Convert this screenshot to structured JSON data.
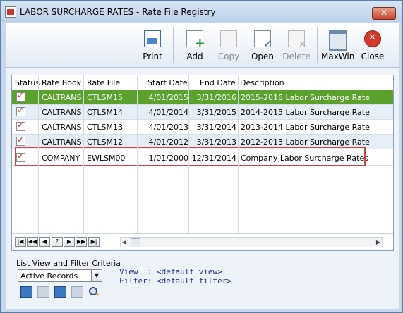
{
  "window": {
    "title": "LABOR SURCHARGE RATES - Rate File Registry",
    "close_symbol": "✕"
  },
  "toolbar": {
    "print_label": "Print",
    "add_label": "Add",
    "copy_label": "Copy",
    "open_label": "Open",
    "delete_label": "Delete",
    "maxwin_label": "MaxWin",
    "close_label": "Close"
  },
  "grid": {
    "columns": [
      "Status",
      "Rate Book",
      "Rate File",
      "Start Date",
      "End Date",
      "Description"
    ],
    "rows": [
      {
        "rate_book": "CALTRANS",
        "rate_file": "CTLSM15",
        "start": "4/01/2015",
        "end": "3/31/2016",
        "desc": "2015-2016 Labor Surcharge Rate",
        "checked": true
      },
      {
        "rate_book": "CALTRANS",
        "rate_file": "CTLSM14",
        "start": "4/01/2014",
        "end": "3/31/2015",
        "desc": "2014-2015 Labor Surcharge Rate",
        "checked": true
      },
      {
        "rate_book": "CALTRANS",
        "rate_file": "CTLSM13",
        "start": "4/01/2013",
        "end": "3/31/2014",
        "desc": "2013-2014 Labor Surcharge Rate",
        "checked": true
      },
      {
        "rate_book": "CALTRANS",
        "rate_file": "CTLSM12",
        "start": "4/01/2012",
        "end": "3/31/2013",
        "desc": "2012-2013 Labor Surcharge Rate",
        "checked": true
      },
      {
        "rate_book": "COMPANY",
        "rate_file": "EWLSM00",
        "start": "1/01/2000",
        "end": "12/31/2014",
        "desc": "Company Labor Surcharge Rates",
        "checked": true
      }
    ],
    "nav": [
      "|◀",
      "◀◀",
      "◀",
      "?",
      "▶",
      "▶▶",
      "▶|"
    ]
  },
  "filter": {
    "section_label": "List View and Filter Criteria",
    "dropdown_value": "Active Records",
    "view_text": "View  : <default view>",
    "filter_text": "Filter: <default filter>"
  },
  "colors": {
    "selected_row": "#5aa12e",
    "highlight_box": "#d64040"
  }
}
